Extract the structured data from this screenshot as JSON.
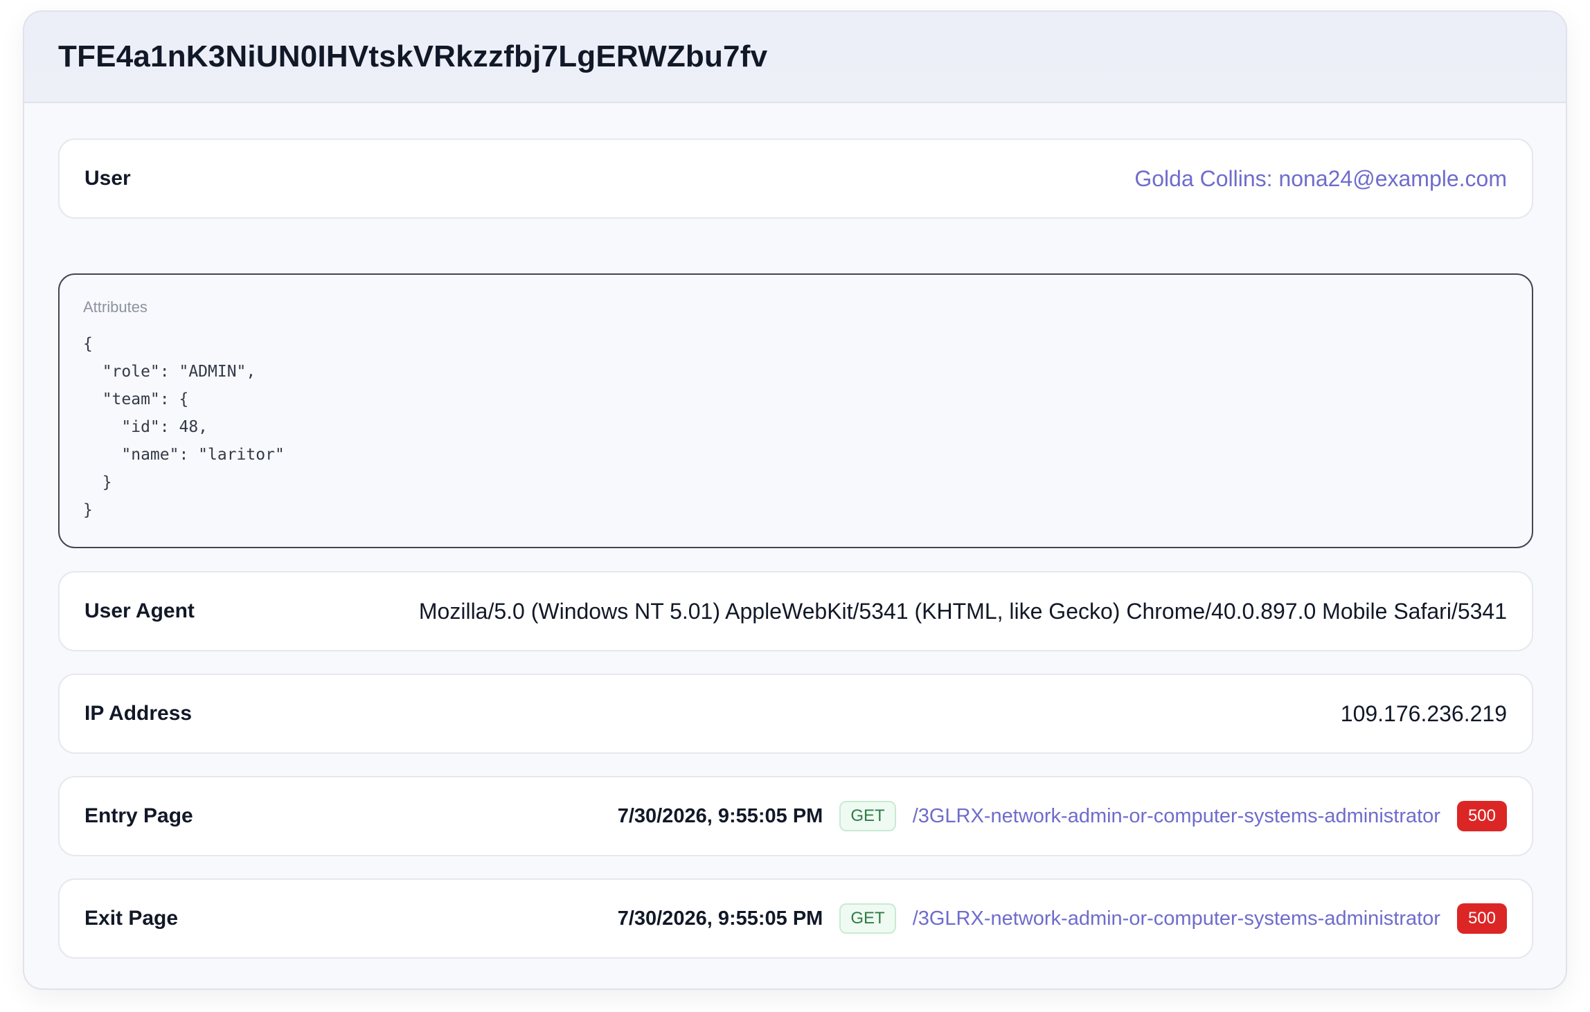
{
  "session": {
    "id": "TFE4a1nK3NiUN0IHVtskVRkzzfbj7LgERWZbu7fv"
  },
  "user": {
    "label": "User",
    "value": "Golda Collins: nona24@example.com"
  },
  "attributes": {
    "label": "Attributes",
    "json": "{\n  \"role\": \"ADMIN\",\n  \"team\": {\n    \"id\": 48,\n    \"name\": \"laritor\"\n  }\n}"
  },
  "user_agent": {
    "label": "User Agent",
    "value": "Mozilla/5.0 (Windows NT 5.01) AppleWebKit/5341 (KHTML, like Gecko) Chrome/40.0.897.0 Mobile Safari/5341"
  },
  "ip_address": {
    "label": "IP Address",
    "value": "109.176.236.219"
  },
  "entry_page": {
    "label": "Entry Page",
    "timestamp": "7/30/2026, 9:55:05 PM",
    "method": "GET",
    "path": "/3GLRX-network-admin-or-computer-systems-administrator",
    "status": "500"
  },
  "exit_page": {
    "label": "Exit Page",
    "timestamp": "7/30/2026, 9:55:05 PM",
    "method": "GET",
    "path": "/3GLRX-network-admin-or-computer-systems-administrator",
    "status": "500"
  },
  "colors": {
    "link": "#6e6ccc",
    "method_green": "#2e7d46",
    "status_red": "#dc2626"
  }
}
